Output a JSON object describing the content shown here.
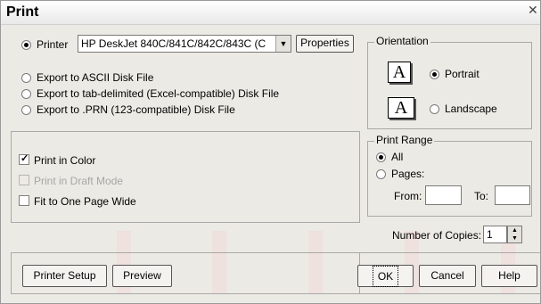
{
  "dialog": {
    "title": "Print"
  },
  "printer": {
    "radio_label": "Printer",
    "selected_printer": "HP DeskJet 840C/841C/842C/843C (C",
    "properties_label": "Properties"
  },
  "export_options": [
    {
      "label": "Export to ASCII Disk File"
    },
    {
      "label": "Export to tab-delimited (Excel-compatible) Disk File"
    },
    {
      "label": "Export to .PRN (123-compatible) Disk File"
    }
  ],
  "options": {
    "print_in_color": {
      "label": "Print in Color",
      "checked": true
    },
    "draft_mode": {
      "label": "Print in Draft Mode",
      "checked": false,
      "enabled": false
    },
    "fit_one_page": {
      "label": "Fit to One Page Wide",
      "checked": false
    }
  },
  "orientation": {
    "title": "Orientation",
    "portrait_label": "Portrait",
    "landscape_label": "Landscape",
    "icon_letter": "A",
    "selected": "Portrait"
  },
  "print_range": {
    "title": "Print Range",
    "all_label": "All",
    "pages_label": "Pages:",
    "from_label": "From:",
    "to_label": "To:",
    "selected": "All"
  },
  "copies": {
    "label": "Number of Copies:",
    "value": "1"
  },
  "buttons": {
    "printer_setup": "Printer Setup",
    "preview": "Preview",
    "ok": "OK",
    "cancel": "Cancel",
    "help": "Help"
  },
  "colors": {
    "dialog_bg": "#eceae4",
    "watermark": "#f2d8d8"
  }
}
